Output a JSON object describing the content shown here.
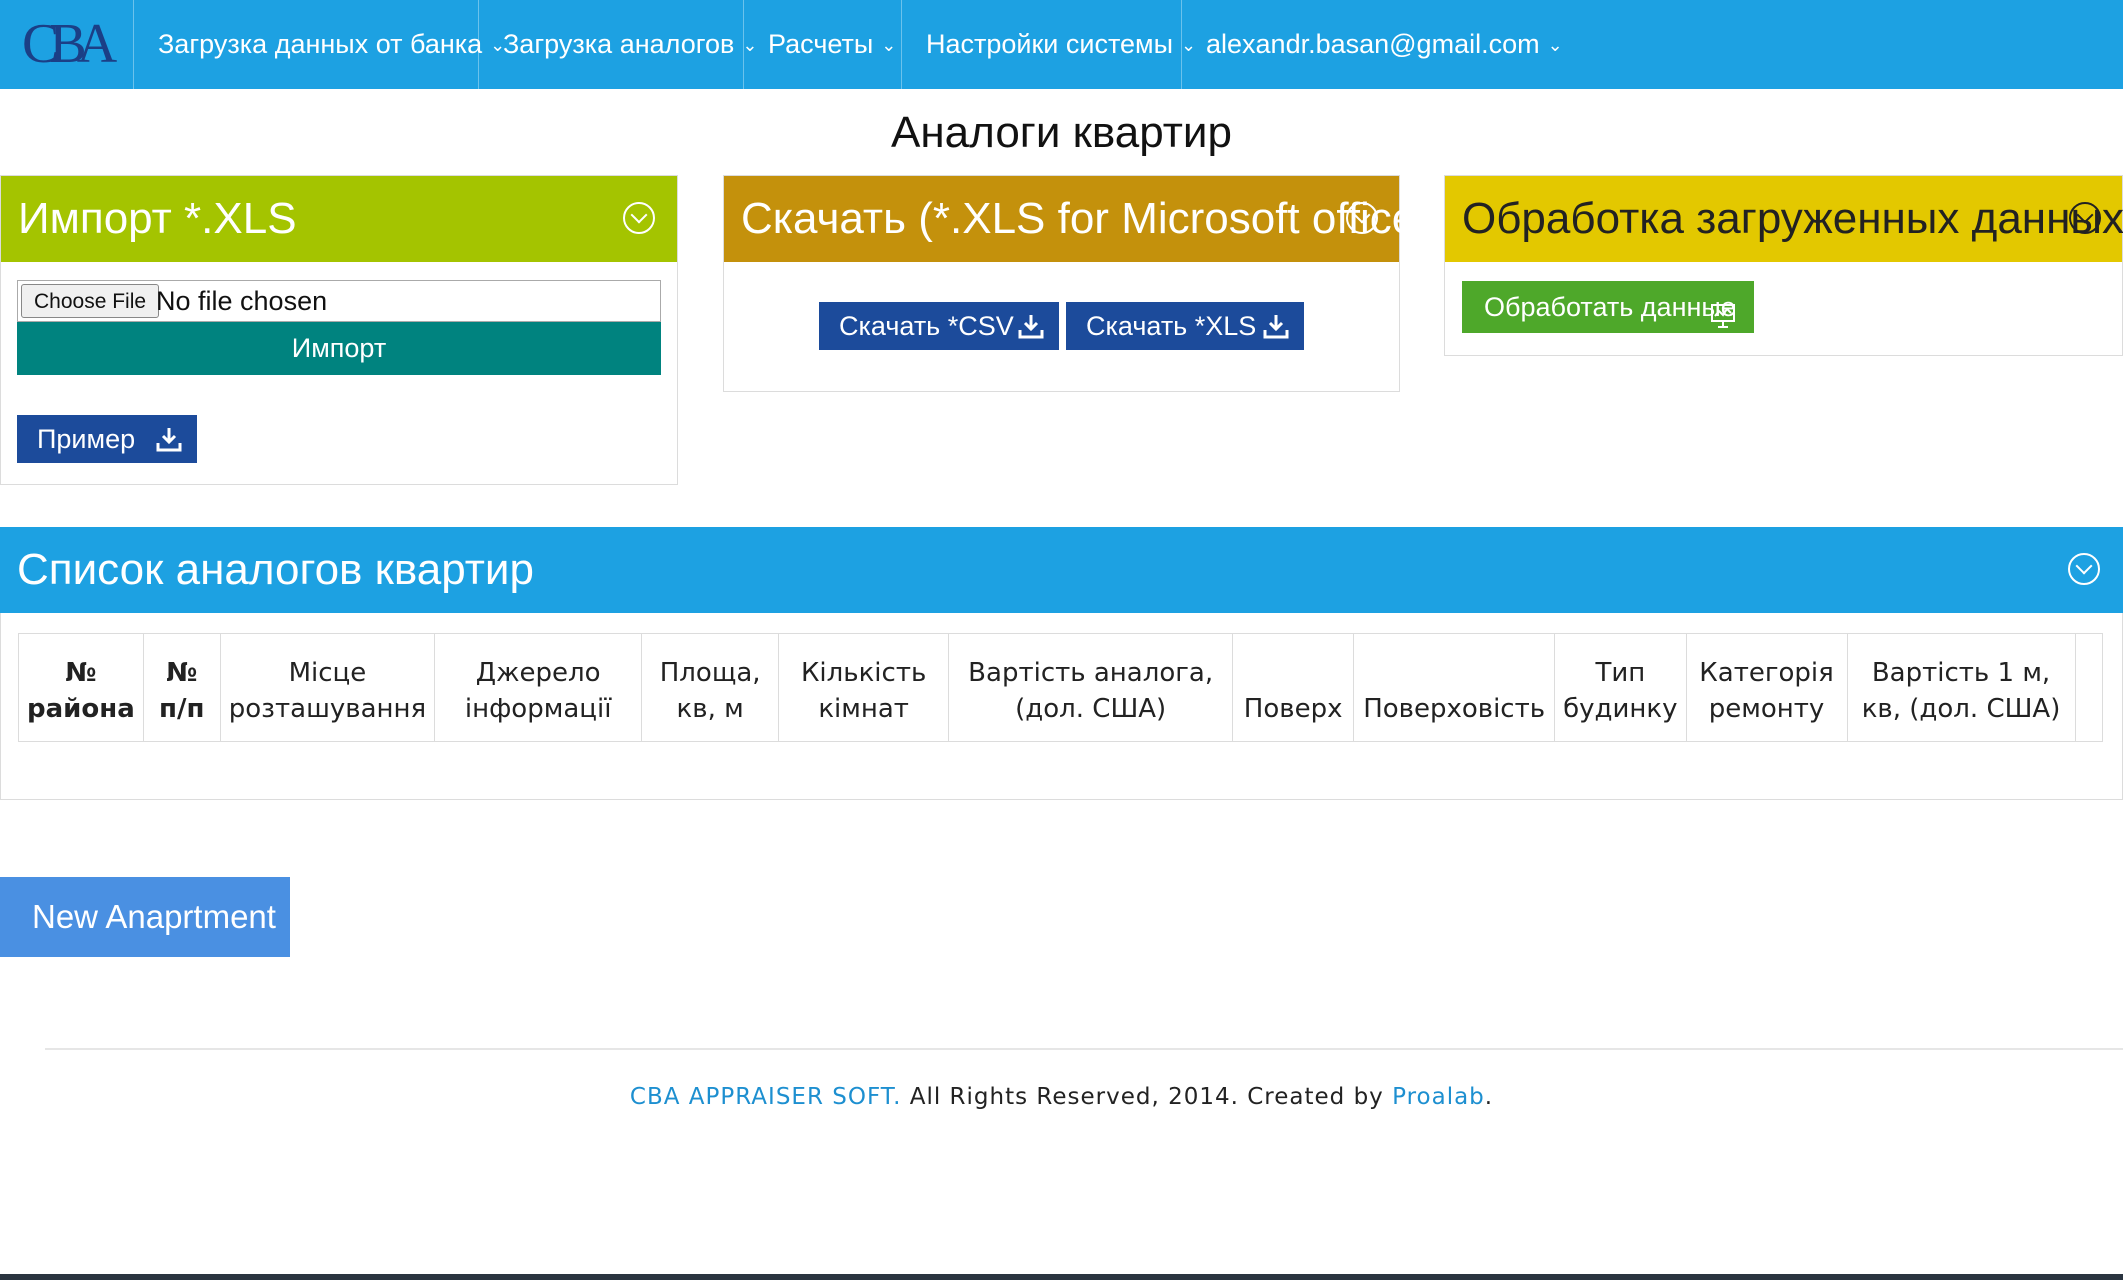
{
  "navbar": {
    "logo_text": "CBA",
    "items": [
      {
        "label": "Загрузка данных от банка"
      },
      {
        "label": "Загрузка аналогов"
      },
      {
        "label": "Расчеты"
      },
      {
        "label": "Настройки системы"
      },
      {
        "label": "alexandr.basan@gmail.com"
      }
    ]
  },
  "page_title": "Аналоги квартир",
  "import_panel": {
    "title": "Импорт *.XLS",
    "header_color": "#a4c400",
    "choose_file_label": "Choose File",
    "file_status": "No file chosen",
    "import_button": "Импорт",
    "example_button": "Пример"
  },
  "download_panel": {
    "title": "Скачать (*.XLS for Microsoft office)",
    "header_color": "#c4910c",
    "csv_button": "Скачать *CSV",
    "xls_button": "Скачать *XLS"
  },
  "process_panel": {
    "title": "Обработка загруженных данных",
    "header_color": "#e3c800",
    "process_button": "Обработать данные"
  },
  "list_panel": {
    "title": "Список аналогов квартир",
    "columns": [
      {
        "line1": "№",
        "line2": "района"
      },
      {
        "line1": "№",
        "line2": "п/п"
      },
      {
        "line1": "Місце",
        "line2": "розташування"
      },
      {
        "line1": "Джерело",
        "line2": "інформації"
      },
      {
        "line1": "Площа,",
        "line2": "кв, м"
      },
      {
        "line1": "Кількість",
        "line2": "кімнат"
      },
      {
        "line1": "Вартість аналога,",
        "line2": "(дол. США)"
      },
      {
        "line1": "",
        "line2": "Поверх"
      },
      {
        "line1": "",
        "line2": "Поверховість"
      },
      {
        "line1": "Тип",
        "line2": "будинку"
      },
      {
        "line1": "Категорія",
        "line2": "ремонту"
      },
      {
        "line1": "Вартість 1 м,",
        "line2": "кв, (дол. США)"
      }
    ]
  },
  "new_apartment_button": "New Anaprtment",
  "footer": {
    "brand": "CBA APPRAISER SOFT.",
    "text": " All Rights Reserved, 2014. Created by ",
    "author": "Proalab",
    "end": "."
  },
  "colors": {
    "navbar": "#1da1e2",
    "button_blue": "#1c4b9b",
    "import_teal": "#00837f",
    "process_green": "#4ea82a",
    "new_button": "#4a90e2"
  }
}
